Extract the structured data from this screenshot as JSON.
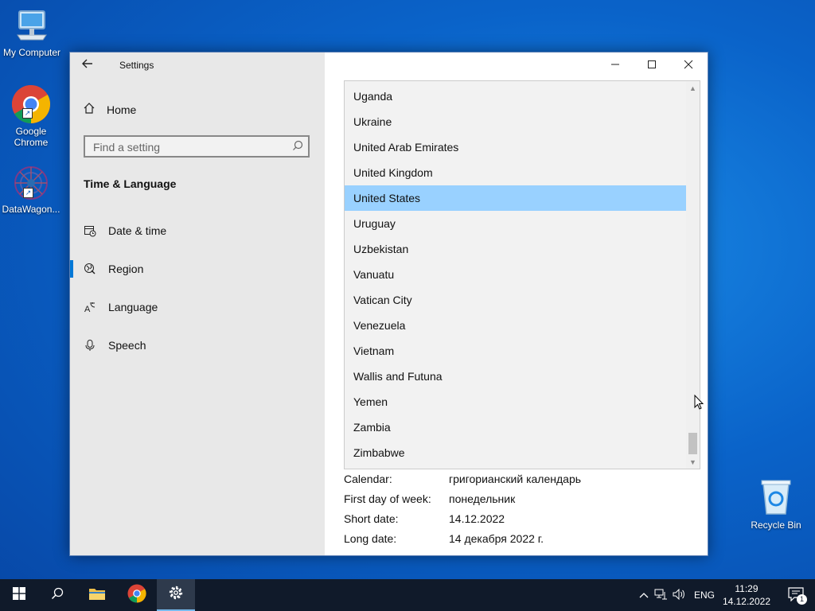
{
  "desktop": {
    "icons": [
      {
        "label": "My Computer"
      },
      {
        "label": "Google Chrome"
      },
      {
        "label": "DataWagon..."
      },
      {
        "label": "Recycle Bin"
      }
    ]
  },
  "window": {
    "title": "Settings",
    "sidebar": {
      "home": "Home",
      "search_placeholder": "Find a setting",
      "section": "Time & Language",
      "items": [
        {
          "label": "Date & time",
          "icon": "calendar-clock-icon"
        },
        {
          "label": "Region",
          "icon": "globe-icon",
          "selected": true
        },
        {
          "label": "Language",
          "icon": "language-icon"
        },
        {
          "label": "Speech",
          "icon": "microphone-icon"
        }
      ]
    },
    "country_list": {
      "items": [
        "Uganda",
        "Ukraine",
        "United Arab Emirates",
        "United Kingdom",
        "United States",
        "Uruguay",
        "Uzbekistan",
        "Vanuatu",
        "Vatican City",
        "Venezuela",
        "Vietnam",
        "Wallis and Futuna",
        "Yemen",
        "Zambia",
        "Zimbabwe"
      ],
      "selected": "United States"
    },
    "region_format": [
      {
        "label": "Calendar:",
        "value": "григорианский календарь"
      },
      {
        "label": "First day of week:",
        "value": "понедельник"
      },
      {
        "label": "Short date:",
        "value": "14.12.2022"
      },
      {
        "label": "Long date:",
        "value": "14 декабря 2022 г."
      }
    ]
  },
  "taskbar": {
    "language": "ENG",
    "time": "11:29",
    "date": "14.12.2022",
    "notification_count": "1"
  },
  "colors": {
    "accent": "#0078d7",
    "selection": "#99d1ff",
    "taskbar": "#101a2a"
  }
}
